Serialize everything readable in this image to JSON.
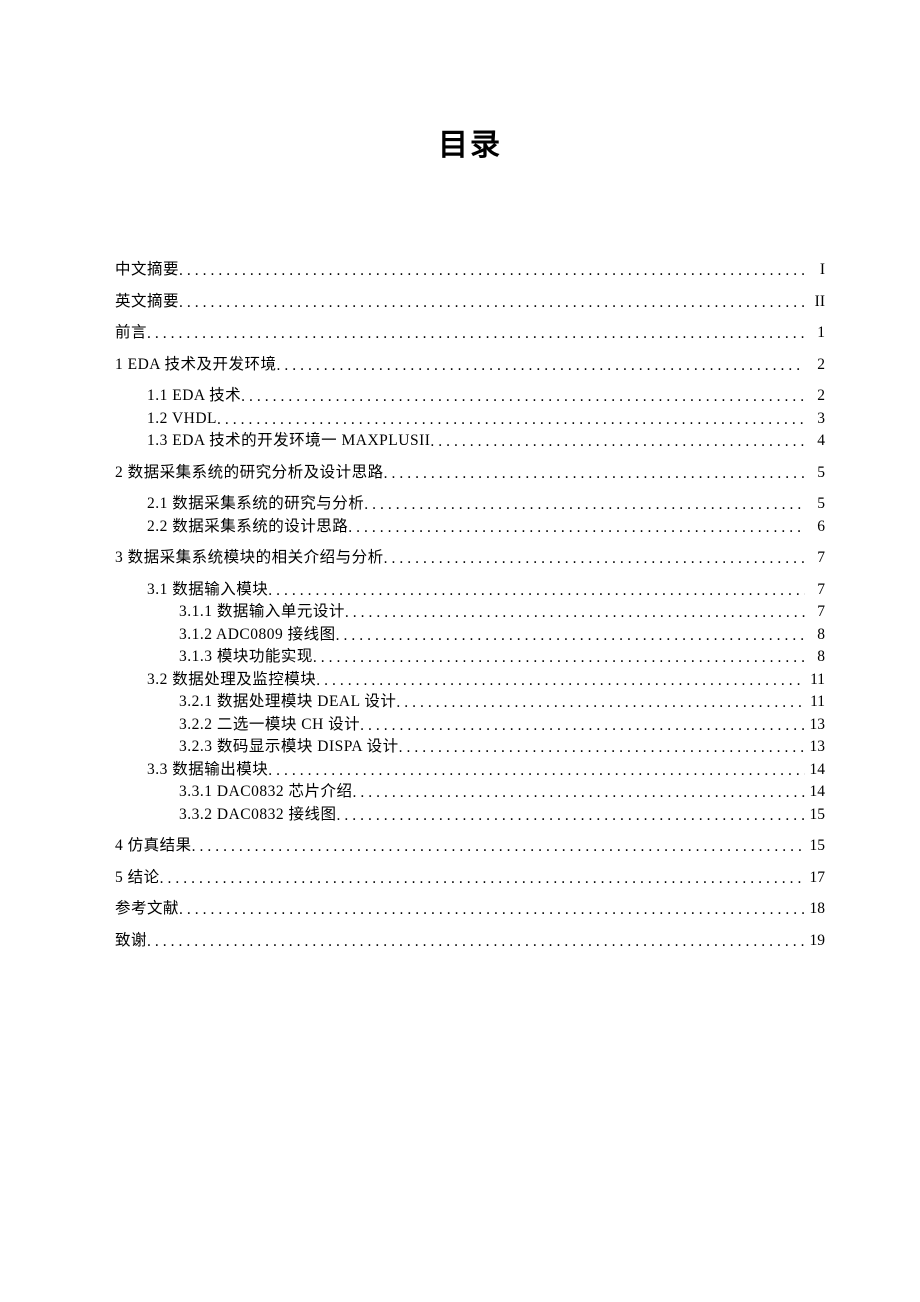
{
  "title": "目录",
  "entries": [
    {
      "label": "中文摘要 ",
      "page": "I",
      "indent": 0,
      "tight": false
    },
    {
      "label": "英文摘要 ",
      "page": "II",
      "indent": 0,
      "tight": false
    },
    {
      "label": "前言 ",
      "page": "1",
      "indent": 0,
      "tight": false
    },
    {
      "label": "1 EDA 技术及开发环境 ",
      "page": "2",
      "indent": 0,
      "tight": false
    },
    {
      "label": "1.1 EDA 技术 ",
      "page": "2",
      "indent": 1,
      "tight": true
    },
    {
      "label": "1.2 VHDL ",
      "page": "3",
      "indent": 1,
      "tight": true
    },
    {
      "label": "1.3 EDA 技术的开发环境一 MAXPLUSII",
      "page": "4",
      "indent": 1,
      "tight": false
    },
    {
      "label": "2 数据采集系统的研究分析及设计思路 ",
      "page": "5",
      "indent": 0,
      "tight": false
    },
    {
      "label": "2.1 数据采集系统的研究与分析 ",
      "page": "5",
      "indent": 1,
      "tight": true
    },
    {
      "label": "2.2 数据采集系统的设计思路 ",
      "page": "6",
      "indent": 1,
      "tight": false
    },
    {
      "label": "3 数据采集系统模块的相关介绍与分析 ",
      "page": "7",
      "indent": 0,
      "tight": false
    },
    {
      "label": "3.1 数据输入模块 ",
      "page": "7",
      "indent": 1,
      "tight": true
    },
    {
      "label": "3.1.1 数据输入单元设计",
      "page": "7",
      "indent": 2,
      "tight": true
    },
    {
      "label": "3.1.2 ADC0809 接线图 ",
      "page": "8",
      "indent": 2,
      "tight": true
    },
    {
      "label": "3.1.3 模块功能实现",
      "page": "8",
      "indent": 2,
      "tight": true
    },
    {
      "label": "3.2 数据处理及监控模块 ",
      "page": "11",
      "indent": 1,
      "tight": true
    },
    {
      "label": "3.2.1 数据处理模块 DEAL 设计",
      "page": " 11",
      "indent": 2,
      "tight": true
    },
    {
      "label": "3.2.2 二选一模块 CH 设计",
      "page": "13",
      "indent": 2,
      "tight": true
    },
    {
      "label": "3.2.3 数码显示模块 DISPA 设计",
      "page": "13",
      "indent": 2,
      "tight": true
    },
    {
      "label": "3.3 数据输出模块",
      "page": "14",
      "indent": 1,
      "tight": true
    },
    {
      "label": "3.3.1 DAC0832 芯片介绍 ",
      "page": "14",
      "indent": 2,
      "tight": true
    },
    {
      "label": "3.3.2 DAC0832 接线图 ",
      "page": "15",
      "indent": 2,
      "tight": false
    },
    {
      "label": "4 仿真结果 ",
      "page": "15",
      "indent": 0,
      "tight": false
    },
    {
      "label": "5 结论",
      "page": "17",
      "indent": 0,
      "tight": false
    },
    {
      "label": "参考文献",
      "page": "18",
      "indent": 0,
      "tight": false
    },
    {
      "label": "致谢 ",
      "page": "19",
      "indent": 0,
      "tight": false
    }
  ]
}
